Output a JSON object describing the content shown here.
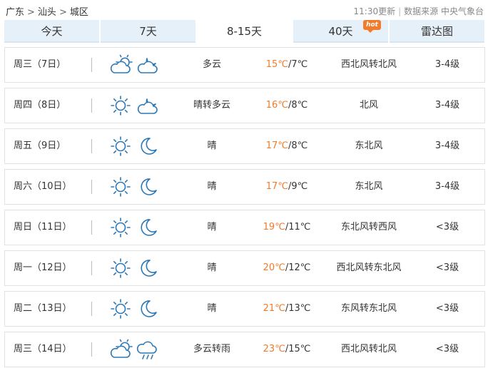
{
  "breadcrumb": [
    "广东",
    "汕头",
    "城区"
  ],
  "breadcrumb_sep": ">",
  "update": "11:30更新",
  "source": "数据来源 中央气象台",
  "tabs": [
    {
      "label": "今天"
    },
    {
      "label": "7天"
    },
    {
      "label": "8-15天",
      "active": true
    },
    {
      "label": "40天",
      "badge": "hot"
    },
    {
      "label": "雷达图"
    }
  ],
  "colors": {
    "high_temp": "#f07b2b",
    "icon": "#2a78b8",
    "tab_bg": "#e6f0f9"
  },
  "forecast": [
    {
      "day": "周三（7日）",
      "icons": [
        "partly-cloudy-day-icon",
        "partly-cloudy-night-icon"
      ],
      "condition": "多云",
      "high": "15℃",
      "low": "/7℃",
      "wind": "西北风转北风",
      "level": "3-4级"
    },
    {
      "day": "周四（8日）",
      "icons": [
        "sun-icon",
        "partly-cloudy-night-icon"
      ],
      "condition": "晴转多云",
      "high": "16℃",
      "low": "/8℃",
      "wind": "北风",
      "level": "3-4级"
    },
    {
      "day": "周五（9日）",
      "icons": [
        "sun-icon",
        "moon-icon"
      ],
      "condition": "晴",
      "high": "17℃",
      "low": "/8℃",
      "wind": "东北风",
      "level": "3-4级"
    },
    {
      "day": "周六（10日）",
      "icons": [
        "sun-icon",
        "moon-icon"
      ],
      "condition": "晴",
      "high": "17℃",
      "low": "/9℃",
      "wind": "东北风",
      "level": "3-4级"
    },
    {
      "day": "周日（11日）",
      "icons": [
        "sun-icon",
        "moon-icon"
      ],
      "condition": "晴",
      "high": "19℃",
      "low": "/11℃",
      "wind": "东北风转西风",
      "level": "<3级"
    },
    {
      "day": "周一（12日）",
      "icons": [
        "sun-icon",
        "moon-icon"
      ],
      "condition": "晴",
      "high": "20℃",
      "low": "/12℃",
      "wind": "西北风转东北风",
      "level": "<3级"
    },
    {
      "day": "周二（13日）",
      "icons": [
        "sun-icon",
        "moon-icon"
      ],
      "condition": "晴",
      "high": "21℃",
      "low": "/13℃",
      "wind": "东风转东北风",
      "level": "<3级"
    },
    {
      "day": "周三（14日）",
      "icons": [
        "partly-cloudy-day-icon",
        "rain-cloud-icon"
      ],
      "condition": "多云转雨",
      "high": "23℃",
      "low": "/15℃",
      "wind": "西北风转北风",
      "level": "<3级"
    }
  ]
}
